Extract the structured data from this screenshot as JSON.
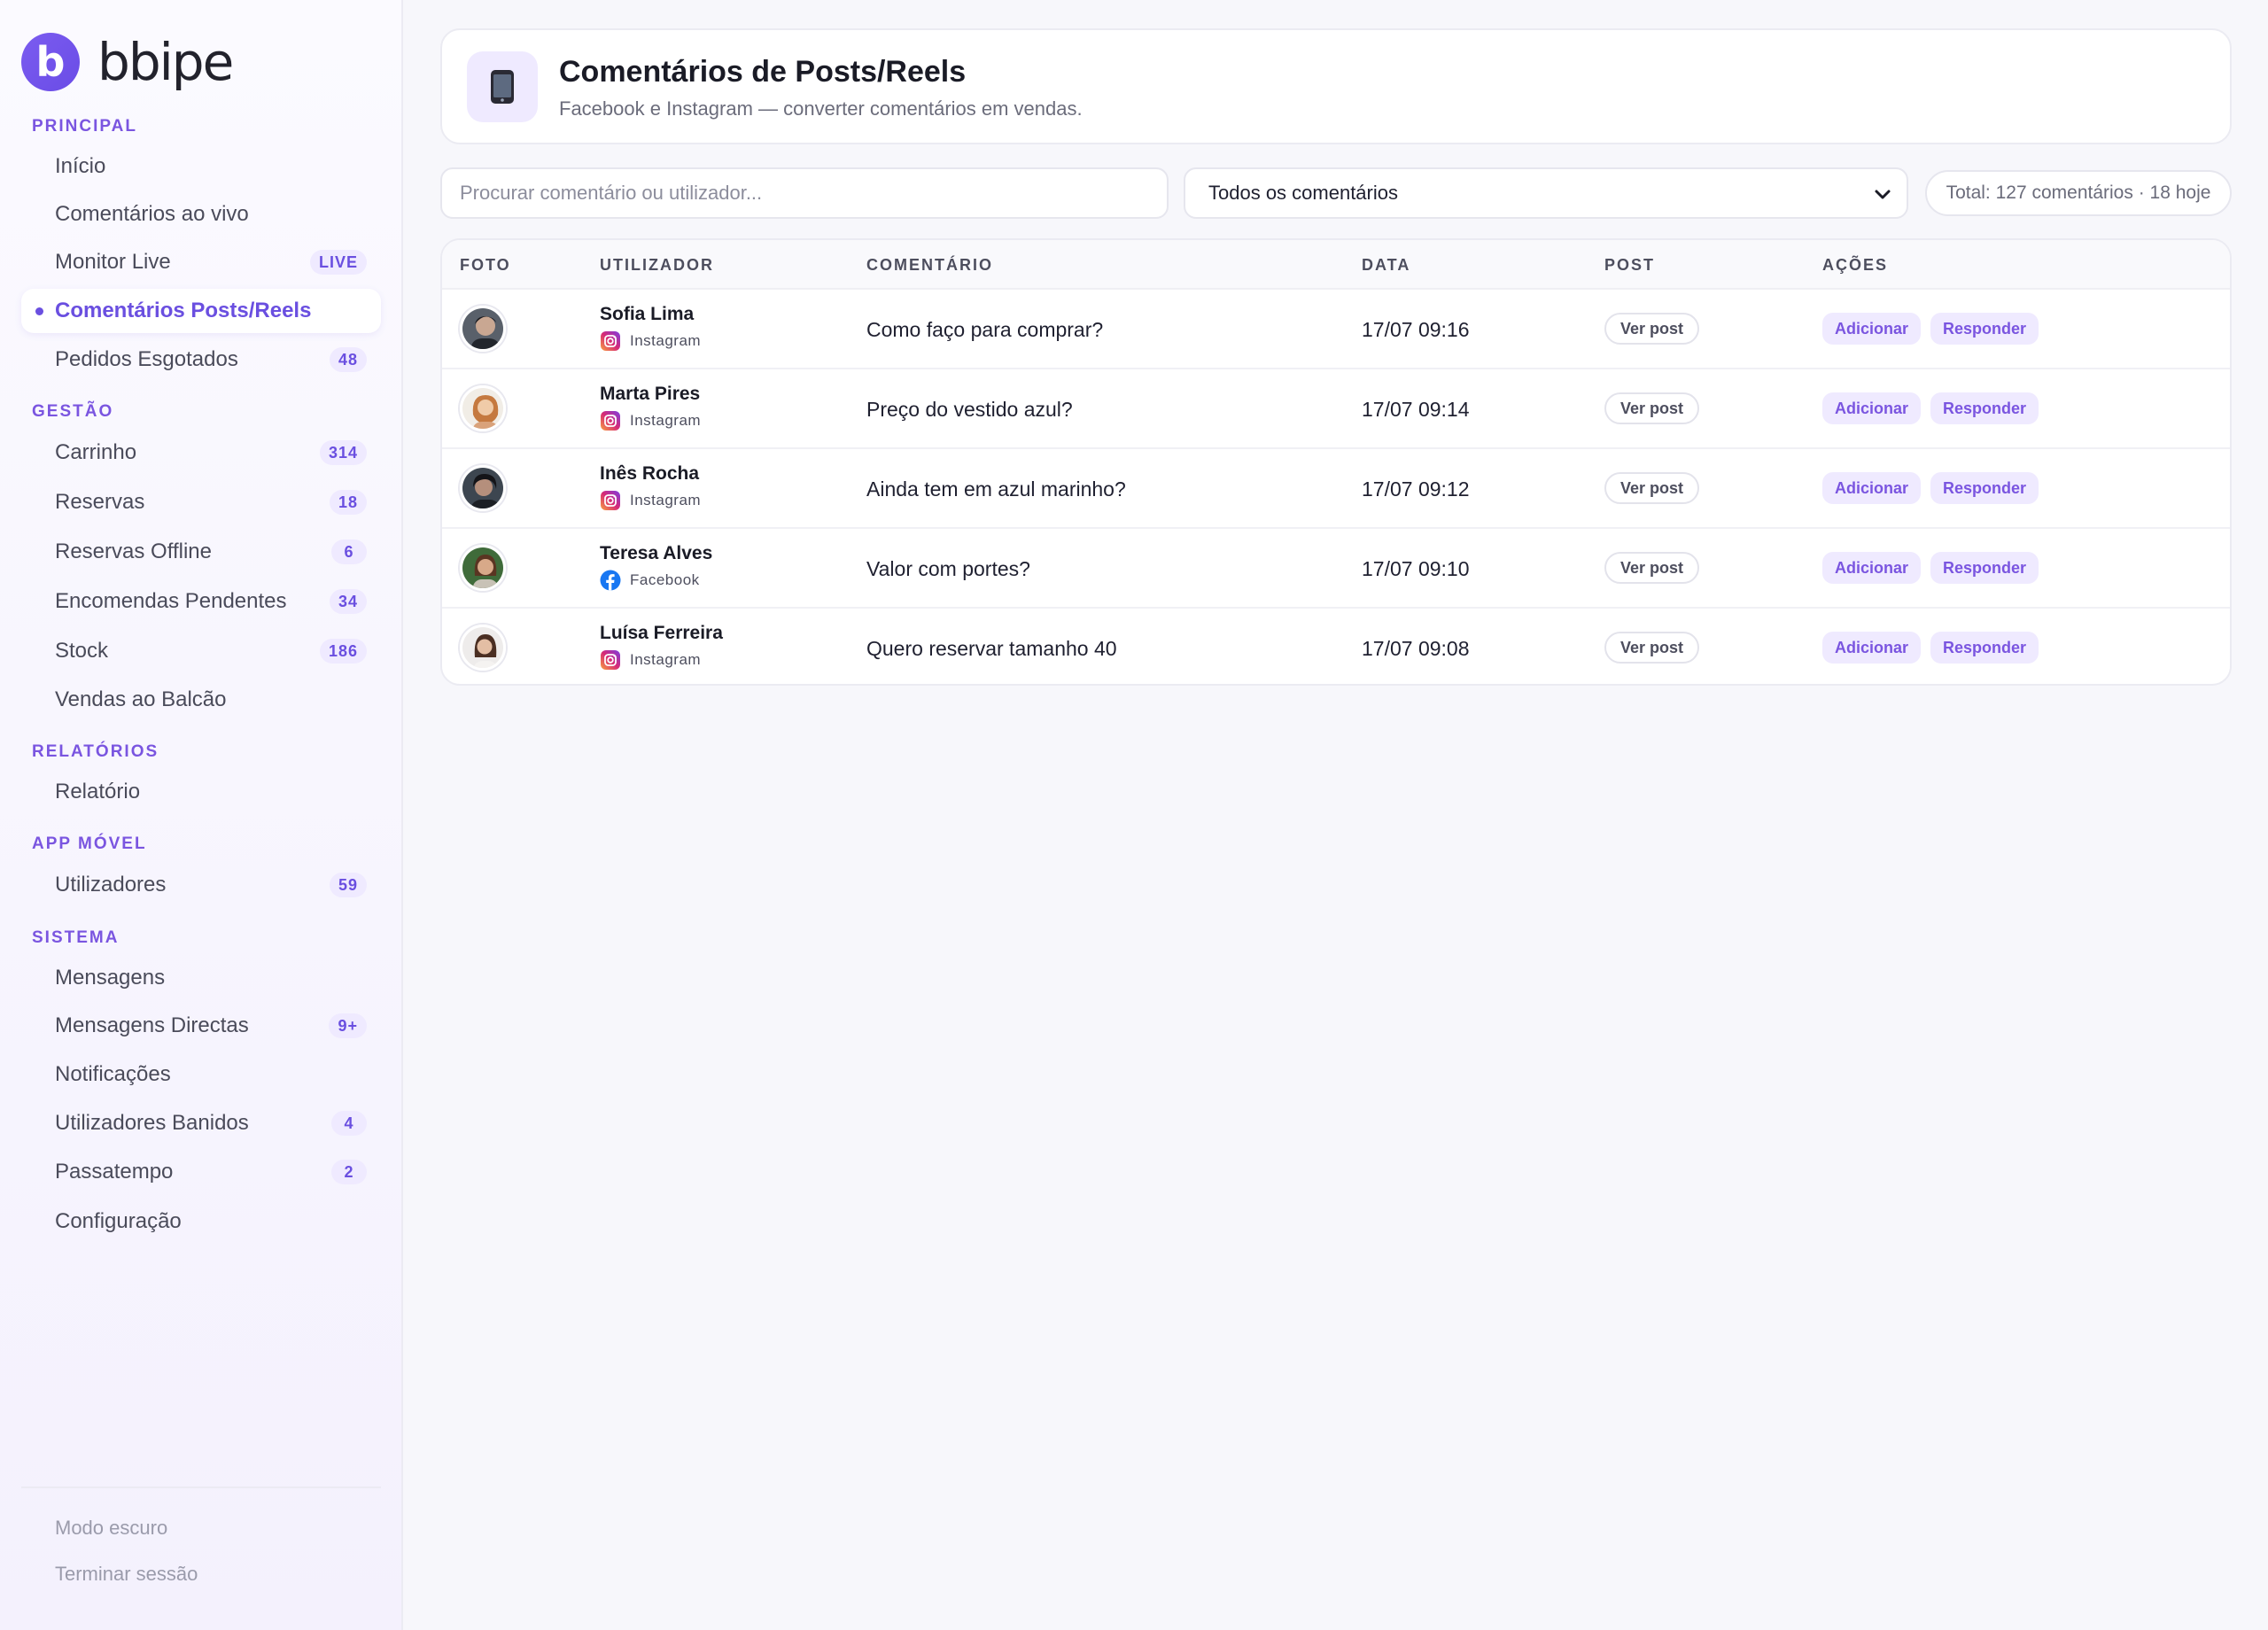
{
  "brand": {
    "name": "bbipe",
    "mark": "b"
  },
  "sidebar": {
    "sections": [
      {
        "label": "PRINCIPAL"
      },
      {
        "label": "GESTÃO"
      },
      {
        "label": "RELATÓRIOS"
      },
      {
        "label": "APP MÓVEL"
      },
      {
        "label": "SISTEMA"
      }
    ],
    "items": [
      {
        "label": "Início"
      },
      {
        "label": "Comentários ao vivo"
      },
      {
        "label": "Monitor Live",
        "badge": "LIVE"
      },
      {
        "label": "Comentários Posts/Reels",
        "active": true
      },
      {
        "label": "Pedidos Esgotados",
        "badge": "48"
      },
      {
        "label": "Carrinho",
        "badge": "314"
      },
      {
        "label": "Reservas",
        "badge": "18"
      },
      {
        "label": "Reservas Offline",
        "badge": "6"
      },
      {
        "label": "Encomendas Pendentes",
        "badge": "34"
      },
      {
        "label": "Stock",
        "badge": "186"
      },
      {
        "label": "Vendas ao Balcão"
      },
      {
        "label": "Relatório"
      },
      {
        "label": "Utilizadores",
        "badge": "59"
      },
      {
        "label": "Mensagens"
      },
      {
        "label": "Mensagens Directas",
        "badge": "9+"
      },
      {
        "label": "Notificações"
      },
      {
        "label": "Utilizadores Banidos",
        "badge": "4"
      },
      {
        "label": "Passatempo",
        "badge": "2"
      },
      {
        "label": "Configuração"
      }
    ],
    "footer": {
      "dark_mode": "Modo escuro",
      "logout": "Terminar sessão"
    }
  },
  "header": {
    "icon": "phone-icon",
    "title": "Comentários de Posts/Reels",
    "subtitle": "Facebook e Instagram — converter comentários em vendas."
  },
  "toolbar": {
    "search_placeholder": "Procurar comentário ou utilizador...",
    "filter_value": "Todos os comentários",
    "total": "Total: 127 comentários · 18 hoje"
  },
  "table": {
    "columns": [
      "FOTO",
      "UTILIZADOR",
      "COMENTÁRIO",
      "DATA",
      "POST",
      "AÇÕES"
    ],
    "rows": [
      {
        "user": "Sofia Lima",
        "platform": "Instagram",
        "comment": "Como faço para comprar?",
        "date": "17/07 09:16",
        "post": "Ver post",
        "add": "Adicionar",
        "reply": "Responder"
      },
      {
        "user": "Marta Pires",
        "platform": "Instagram",
        "comment": "Preço do vestido azul?",
        "date": "17/07 09:14",
        "post": "Ver post",
        "add": "Adicionar",
        "reply": "Responder"
      },
      {
        "user": "Inês Rocha",
        "platform": "Instagram",
        "comment": "Ainda tem em azul marinho?",
        "date": "17/07 09:12",
        "post": "Ver post",
        "add": "Adicionar",
        "reply": "Responder"
      },
      {
        "user": "Teresa Alves",
        "platform": "Facebook",
        "comment": "Valor com portes?",
        "date": "17/07 09:10",
        "post": "Ver post",
        "add": "Adicionar",
        "reply": "Responder"
      },
      {
        "user": "Luísa Ferreira",
        "platform": "Instagram",
        "comment": "Quero reservar tamanho 40",
        "date": "17/07 09:08",
        "post": "Ver post",
        "add": "Adicionar",
        "reply": "Responder"
      }
    ]
  },
  "colors": {
    "accent": "#6a4fe0",
    "accent_soft": "#efeaff",
    "instagram": "#d62976",
    "facebook": "#1877f2"
  }
}
